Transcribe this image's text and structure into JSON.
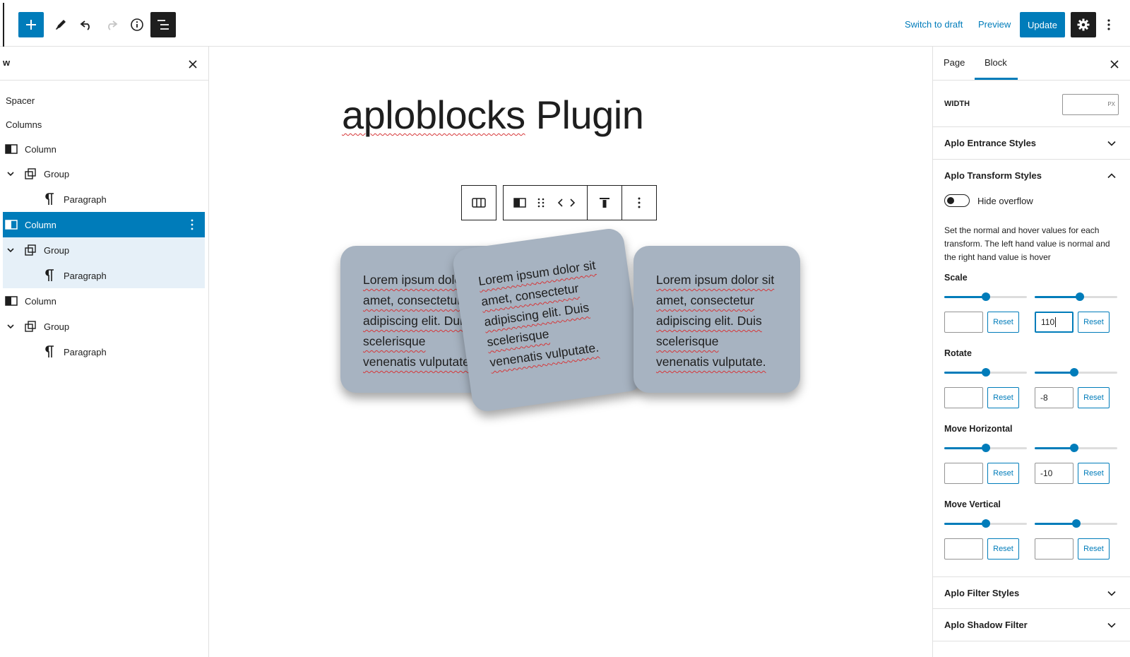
{
  "topbar": {
    "switch_to_draft": "Switch to draft",
    "preview": "Preview",
    "update": "Update"
  },
  "list_view": {
    "title": "w",
    "items": [
      {
        "label": "Spacer",
        "icon": "none"
      },
      {
        "label": "Columns",
        "icon": "none"
      },
      {
        "label": "Column",
        "icon": "column-icon"
      },
      {
        "label": "Group",
        "icon": "group-icon"
      },
      {
        "label": "Paragraph",
        "icon": "paragraph-icon"
      },
      {
        "label": "Column",
        "icon": "column-icon"
      },
      {
        "label": "Group",
        "icon": "group-icon"
      },
      {
        "label": "Paragraph",
        "icon": "paragraph-icon"
      },
      {
        "label": "Column",
        "icon": "column-icon"
      },
      {
        "label": "Group",
        "icon": "group-icon"
      },
      {
        "label": "Paragraph",
        "icon": "paragraph-icon"
      }
    ]
  },
  "canvas": {
    "title_word1": "aploblocks",
    "title_word2": "Plugin",
    "card_text": "Lorem ipsum dolor sit amet, consectetur adipiscing elit. Duis scelerisque venenatis vulputate.",
    "card1": {
      "l1": "Lorem ipsum dolo",
      "l2": "amet, consectetur",
      "l3": "adipiscing elit. Duis",
      "l4": "scelerisque",
      "l5": "venenatis vulputate."
    },
    "card2": {
      "l1": "Lorem ipsum dolor sit",
      "l2": "amet, consectetur",
      "l3": "adipiscing elit. Duis",
      "l4": "scelerisque",
      "l5": "venenatis vulputate."
    },
    "card3": {
      "l1": "Lorem ipsum dolor sit",
      "l2": "amet, consectetur",
      "l3": "adipiscing elit. Duis",
      "l4": "scelerisque",
      "l5": "venenatis vulputate."
    }
  },
  "sidebar": {
    "tab_page": "Page",
    "tab_block": "Block",
    "width_label": "WIDTH",
    "width_unit": "PX",
    "panel_entrance": "Aplo Entrance Styles",
    "panel_transform": "Aplo Transform Styles",
    "hide_overflow": "Hide overflow",
    "help_text": "Set the normal and hover values for each transform. The left hand value is normal and the right hand value is hover",
    "reset_label": "Reset",
    "controls": [
      {
        "label": "Scale",
        "normal_value": "",
        "hover_value": "110",
        "normal_pct": 0.5,
        "hover_pct": 0.55
      },
      {
        "label": "Rotate",
        "normal_value": "",
        "hover_value": "-8",
        "normal_pct": 0.5,
        "hover_pct": 0.48
      },
      {
        "label": "Move Horizontal",
        "normal_value": "",
        "hover_value": "-10",
        "normal_pct": 0.5,
        "hover_pct": 0.48
      },
      {
        "label": "Move Vertical",
        "normal_value": "",
        "hover_value": "",
        "normal_pct": 0.5,
        "hover_pct": 0.5
      }
    ],
    "panel_filter": "Aplo Filter Styles",
    "panel_shadow": "Aplo Shadow Filter"
  },
  "colors": {
    "accent": "#007cba",
    "card_bg": "#a7b3c1",
    "dark": "#1e1e1e"
  }
}
